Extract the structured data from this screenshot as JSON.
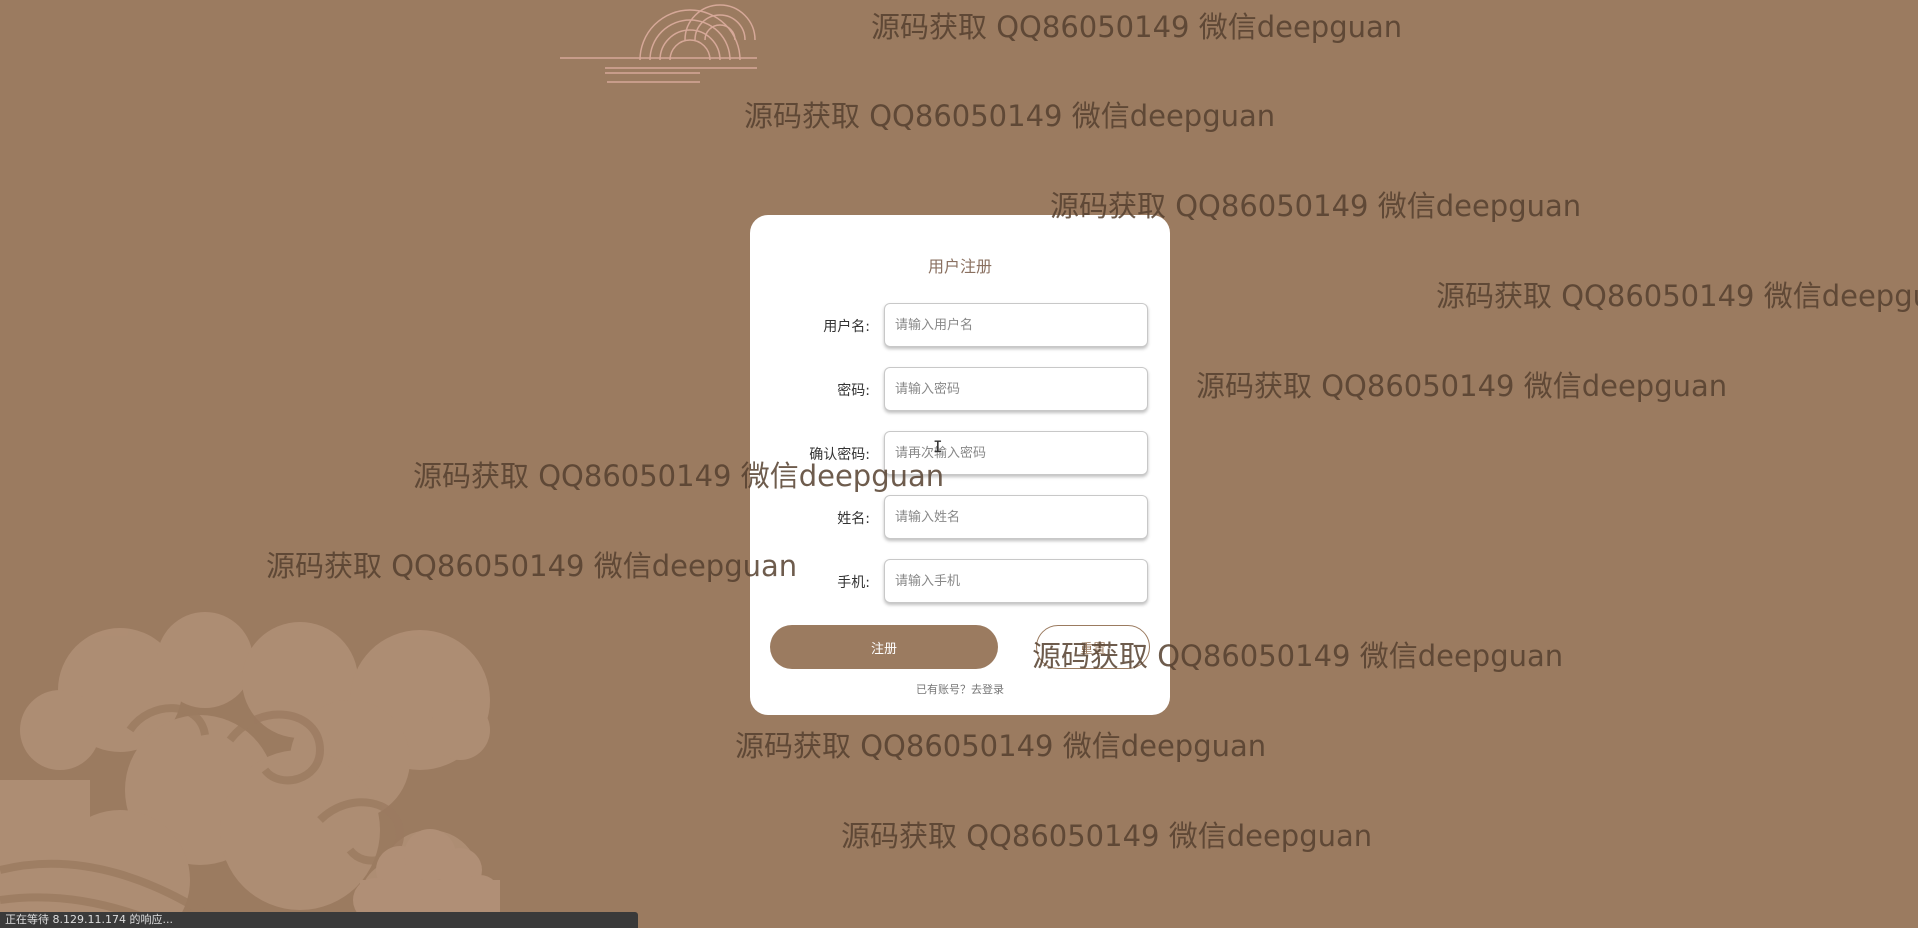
{
  "page": {
    "background_color": "#9b7b60"
  },
  "watermark_text": "源码获取 QQ86050149 微信deepguan",
  "form": {
    "title": "用户注册",
    "fields": [
      {
        "label": "用户名:",
        "placeholder": "请输入用户名"
      },
      {
        "label": "密码:",
        "placeholder": "请输入密码"
      },
      {
        "label": "确认密码:",
        "placeholder": "请再次输入密码"
      },
      {
        "label": "姓名:",
        "placeholder": "请输入姓名"
      },
      {
        "label": "手机:",
        "placeholder": "请输入手机"
      }
    ],
    "register_button": "注册",
    "reset_button": "重置",
    "login_link": "已有账号？去登录"
  },
  "status_bar": {
    "text": "正在等待 8.129.11.174 的响应..."
  },
  "colors": {
    "accent": "#9b7b60",
    "card": "#ffffff",
    "watermark": "#55402f"
  }
}
